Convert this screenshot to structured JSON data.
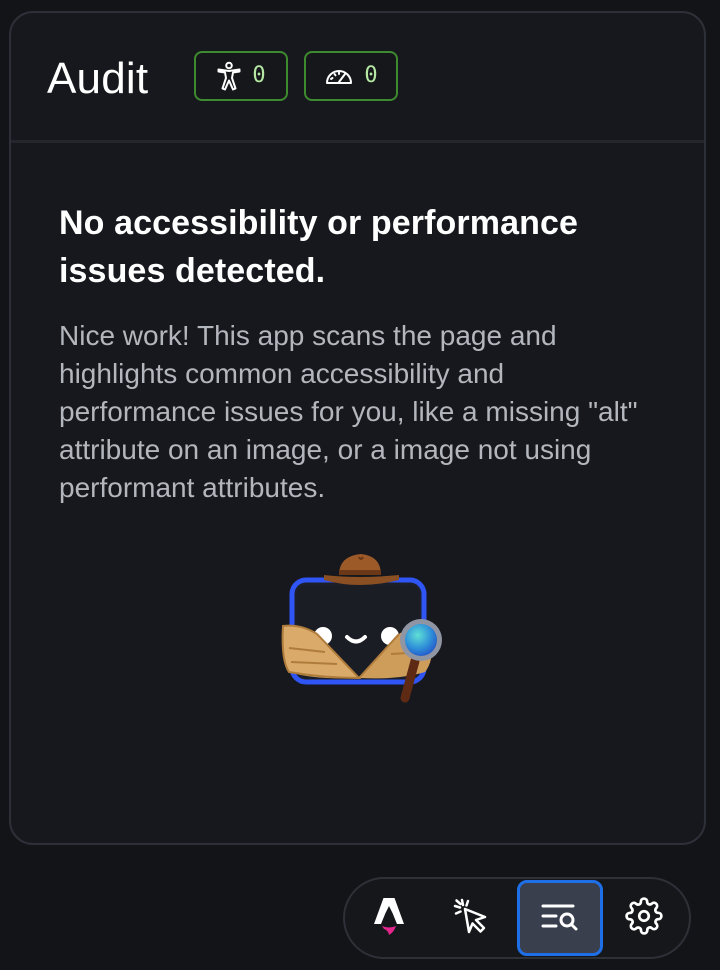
{
  "panel": {
    "title": "Audit",
    "badges": [
      {
        "icon": "accessibility-icon",
        "count": "0"
      },
      {
        "icon": "gauge-icon",
        "count": "0"
      }
    ]
  },
  "empty_state": {
    "heading": "No accessibility or performance issues detected.",
    "description": "Nice work! This app scans the page and highlights common accessibility and performance issues for you, like a missing \"alt\" attribute on an image, or a image not using performant attributes."
  },
  "toolbar": {
    "items": [
      {
        "name": "astro-logo-icon",
        "active": false
      },
      {
        "name": "inspect-cursor-icon",
        "active": false
      },
      {
        "name": "audit-icon",
        "active": true
      },
      {
        "name": "gear-icon",
        "active": false
      }
    ]
  },
  "colors": {
    "background": "#131418",
    "panel": "#17181d",
    "badge_border": "#3d8a2f",
    "badge_text": "#b6e8a4",
    "active_tool_border": "#1f6fe8",
    "active_tool_bg": "#3a3f4d"
  }
}
